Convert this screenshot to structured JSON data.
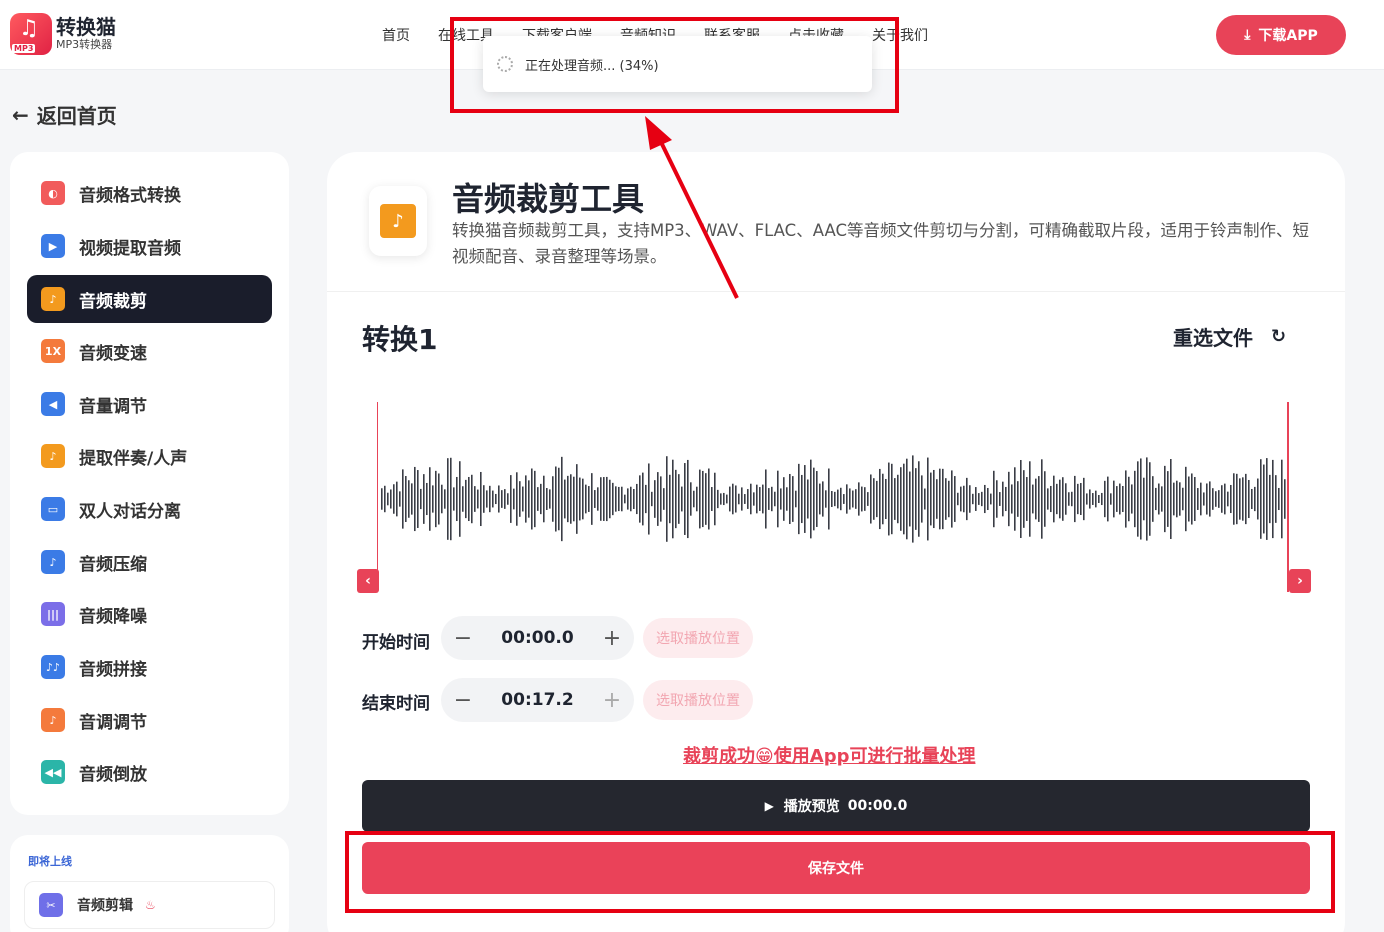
{
  "header": {
    "logo_title": "转换猫",
    "logo_subtitle": "MP3转换器",
    "logo_badge": "MP3",
    "nav": [
      "首页",
      "在线工具",
      "下载客户端",
      "音频知识",
      "联系客服",
      "点击收藏",
      "关于我们"
    ],
    "download_button": "下载APP"
  },
  "toast": {
    "message": "正在处理音频... (34%)",
    "progress_percent": 34
  },
  "back_label": "返回首页",
  "sidebar": {
    "items": [
      {
        "label": "音频格式转换",
        "icon": "audio-convert-icon",
        "color": "#f15b5b",
        "glyph": "◐"
      },
      {
        "label": "视频提取音频",
        "icon": "video-extract-icon",
        "color": "#3b7be6",
        "glyph": "▶"
      },
      {
        "label": "音频裁剪",
        "icon": "audio-cut-icon",
        "color": "#f39a1e",
        "glyph": "♪",
        "active": true
      },
      {
        "label": "音频变速",
        "icon": "speed-icon",
        "color": "#f47a3c",
        "glyph": "1X"
      },
      {
        "label": "音量调节",
        "icon": "volume-icon",
        "color": "#3b7be6",
        "glyph": "◀"
      },
      {
        "label": "提取伴奏/人声",
        "icon": "vocal-icon",
        "color": "#f39a1e",
        "glyph": "♪"
      },
      {
        "label": "双人对话分离",
        "icon": "dialog-icon",
        "color": "#3b7be6",
        "glyph": "▭"
      },
      {
        "label": "音频压缩",
        "icon": "compress-icon",
        "color": "#3b7be6",
        "glyph": "♪"
      },
      {
        "label": "音频降噪",
        "icon": "denoise-icon",
        "color": "#7b6ee8",
        "glyph": "|||"
      },
      {
        "label": "音频拼接",
        "icon": "join-icon",
        "color": "#3b7be6",
        "glyph": "♪♪"
      },
      {
        "label": "音调调节",
        "icon": "pitch-icon",
        "color": "#f47a3c",
        "glyph": "♪"
      },
      {
        "label": "音频倒放",
        "icon": "reverse-icon",
        "color": "#2bb5a8",
        "glyph": "◀◀"
      }
    ],
    "coming_soon_label": "即将上线",
    "coming_soon_item": "音频剪辑",
    "coming_soon_badge": "♨"
  },
  "tool": {
    "title": "音频裁剪工具",
    "description": "转换猫音频裁剪工具，支持MP3、WAV、FLAC、AAC等音频文件剪切与分割，可精确截取片段，适用于铃声制作、短视频配音、录音整理等场景。",
    "icon_glyph": "♪"
  },
  "file": {
    "name": "转换1",
    "reselect_label": "重选文件"
  },
  "controls": {
    "start_label": "开始时间",
    "start_value": "00:00.0",
    "end_label": "结束时间",
    "end_value": "00:17.2",
    "pick_label": "选取播放位置",
    "success_text": "裁剪成功😁使用App可进行批量处理",
    "play_label": "播放预览",
    "play_time": "00:00.0",
    "save_label": "保存文件"
  },
  "colors": {
    "accent": "#e84358",
    "dark": "#1a1d2b",
    "annotation": "#e60012"
  }
}
